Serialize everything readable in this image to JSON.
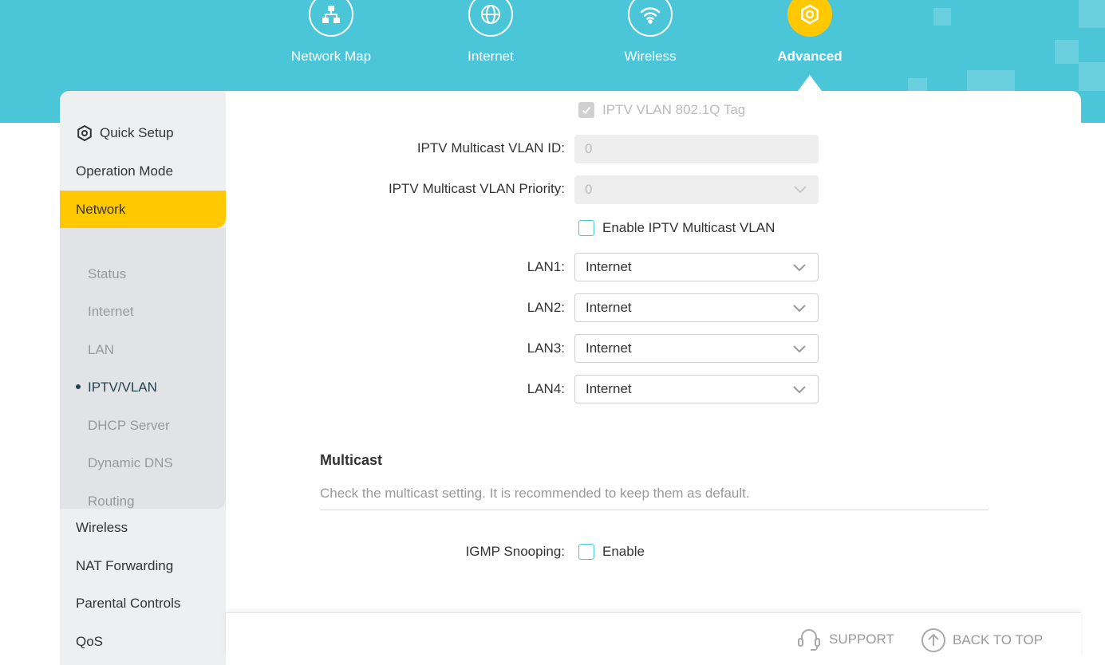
{
  "top_nav": {
    "items": [
      {
        "label": "Network Map",
        "icon": "network-map-icon"
      },
      {
        "label": "Internet",
        "icon": "globe-icon"
      },
      {
        "label": "Wireless",
        "icon": "wifi-icon"
      },
      {
        "label": "Advanced",
        "icon": "gear-icon",
        "active": true
      }
    ]
  },
  "sidebar": {
    "quick_setup": "Quick Setup",
    "operation_mode": "Operation Mode",
    "network": "Network",
    "network_sub": [
      "Status",
      "Internet",
      "LAN",
      "IPTV/VLAN",
      "DHCP Server",
      "Dynamic DNS",
      "Routing"
    ],
    "current_sub": "IPTV/VLAN",
    "after": [
      "Wireless",
      "NAT Forwarding",
      "Parental Controls",
      "QoS"
    ]
  },
  "iptv": {
    "vlan_tag_label": "IPTV VLAN 802.1Q Tag",
    "multicast_vlan_id_label": "IPTV Multicast VLAN ID:",
    "multicast_vlan_id_value": "0",
    "multicast_vlan_priority_label": "IPTV Multicast VLAN Priority:",
    "multicast_vlan_priority_value": "0",
    "enable_multicast_vlan_label": "Enable IPTV Multicast VLAN",
    "lan": [
      {
        "label": "LAN1:",
        "value": "Internet"
      },
      {
        "label": "LAN2:",
        "value": "Internet"
      },
      {
        "label": "LAN3:",
        "value": "Internet"
      },
      {
        "label": "LAN4:",
        "value": "Internet"
      }
    ]
  },
  "multicast": {
    "title": "Multicast",
    "description": "Check the multicast setting. It is recommended to keep them as default.",
    "igmp_label": "IGMP Snooping:",
    "igmp_enable": "Enable"
  },
  "footer": {
    "support": "SUPPORT",
    "back_to_top": "BACK TO TOP"
  },
  "colors": {
    "accent": "#4ac6d8",
    "active": "#ffc800"
  }
}
